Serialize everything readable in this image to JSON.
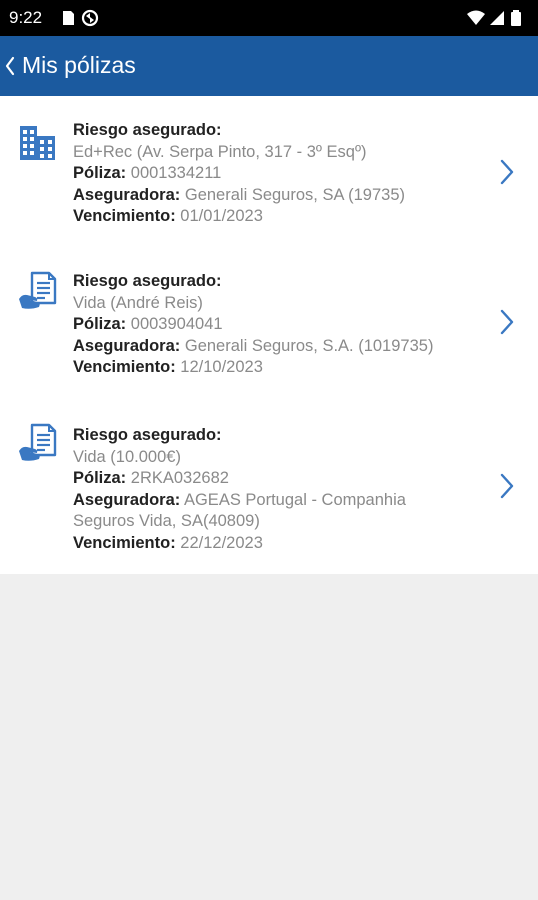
{
  "status_bar": {
    "time": "9:22",
    "left_icons": [
      "sd-card-icon",
      "sync-icon"
    ],
    "right_icons": [
      "wifi-icon",
      "signal-icon",
      "battery-icon"
    ]
  },
  "app_bar": {
    "title": "Mis pólizas",
    "background": "#1b5a9f"
  },
  "policies": [
    {
      "icon": "building-icon",
      "risk_label": "Riesgo asegurado:",
      "risk_value": "Ed+Rec (Av. Serpa Pinto, 317 - 3º Esqº)",
      "policy_label": "Póliza:",
      "policy_value": "0001334211",
      "insurer_label": "Aseguradora:",
      "insurer_value": "Generali Seguros, SA (19735)",
      "expiry_label": "Vencimiento:",
      "expiry_value": "01/01/2023"
    },
    {
      "icon": "life-policy-icon",
      "risk_label": "Riesgo asegurado:",
      "risk_value": "Vida (André Reis)",
      "policy_label": "Póliza:",
      "policy_value": "0003904041",
      "insurer_label": "Aseguradora:",
      "insurer_value": "Generali Seguros, S.A. (1019735)",
      "expiry_label": "Vencimiento:",
      "expiry_value": "12/10/2023"
    },
    {
      "icon": "life-policy-icon",
      "risk_label": "Riesgo asegurado:",
      "risk_value": "Vida (10.000€)",
      "policy_label": "Póliza:",
      "policy_value": "2RKA032682",
      "insurer_label": "Aseguradora:",
      "insurer_value": "AGEAS Portugal - Companhia Seguros Vida, SA(40809)",
      "expiry_label": "Vencimiento:",
      "expiry_value": "22/12/2023"
    }
  ],
  "colors": {
    "accent": "#3a78c2",
    "label_text": "#222222",
    "value_text": "#8a8a8a",
    "empty_background": "#efefef"
  }
}
